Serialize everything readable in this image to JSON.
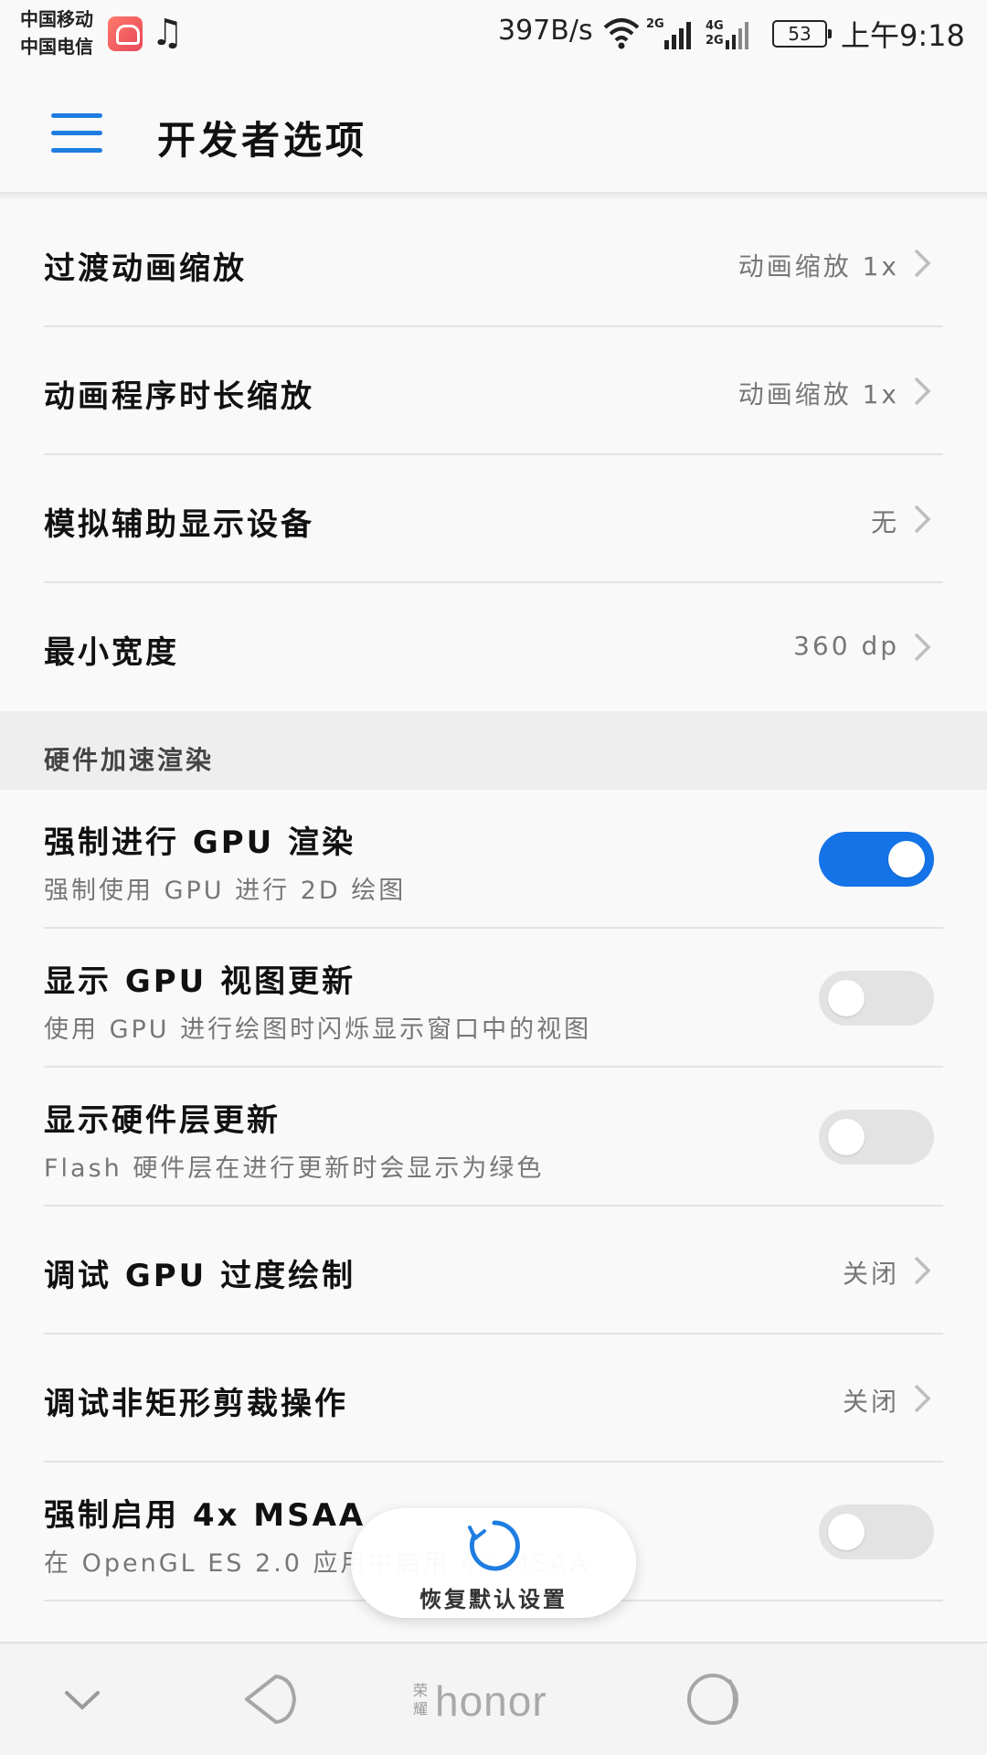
{
  "status_bar": {
    "carrier1": "中国移动",
    "carrier2": "中国电信",
    "net_speed": "397B/s",
    "sig1_label": "2G",
    "sig2_label_top": "4G",
    "sig2_label_bottom": "2G",
    "battery": "53",
    "time": "上午9:18"
  },
  "header": {
    "title": "开发者选项"
  },
  "rows_top": [
    {
      "title": "过渡动画缩放",
      "value": "动画缩放 1x"
    },
    {
      "title": "动画程序时长缩放",
      "value": "动画缩放 1x"
    },
    {
      "title": "模拟辅助显示设备",
      "value": "无"
    },
    {
      "title": "最小宽度",
      "value": "360 dp"
    }
  ],
  "section": {
    "label": "硬件加速渲染"
  },
  "toggles": [
    {
      "title": "强制进行 GPU 渲染",
      "subtitle": "强制使用 GPU 进行 2D 绘图",
      "on": true
    },
    {
      "title": "显示 GPU 视图更新",
      "subtitle": "使用 GPU 进行绘图时闪烁显示窗口中的视图",
      "on": false
    },
    {
      "title": "显示硬件层更新",
      "subtitle": "Flash 硬件层在进行更新时会显示为绿色",
      "on": false
    }
  ],
  "rows_mid": [
    {
      "title": "调试 GPU 过度绘制",
      "value": "关闭"
    },
    {
      "title": "调试非矩形剪裁操作",
      "value": "关闭"
    }
  ],
  "msaa": {
    "title": "强制启用 4x MSAA",
    "subtitle": "在 OpenGL ES 2.0 应用中启用 4x MSAA",
    "on": false
  },
  "restore_button": {
    "label": "恢复默认设置"
  },
  "navbar": {
    "brand_small": "荣耀",
    "brand": "honor"
  },
  "colors": {
    "accent": "#1473e6",
    "menu": "#1e7de0"
  }
}
